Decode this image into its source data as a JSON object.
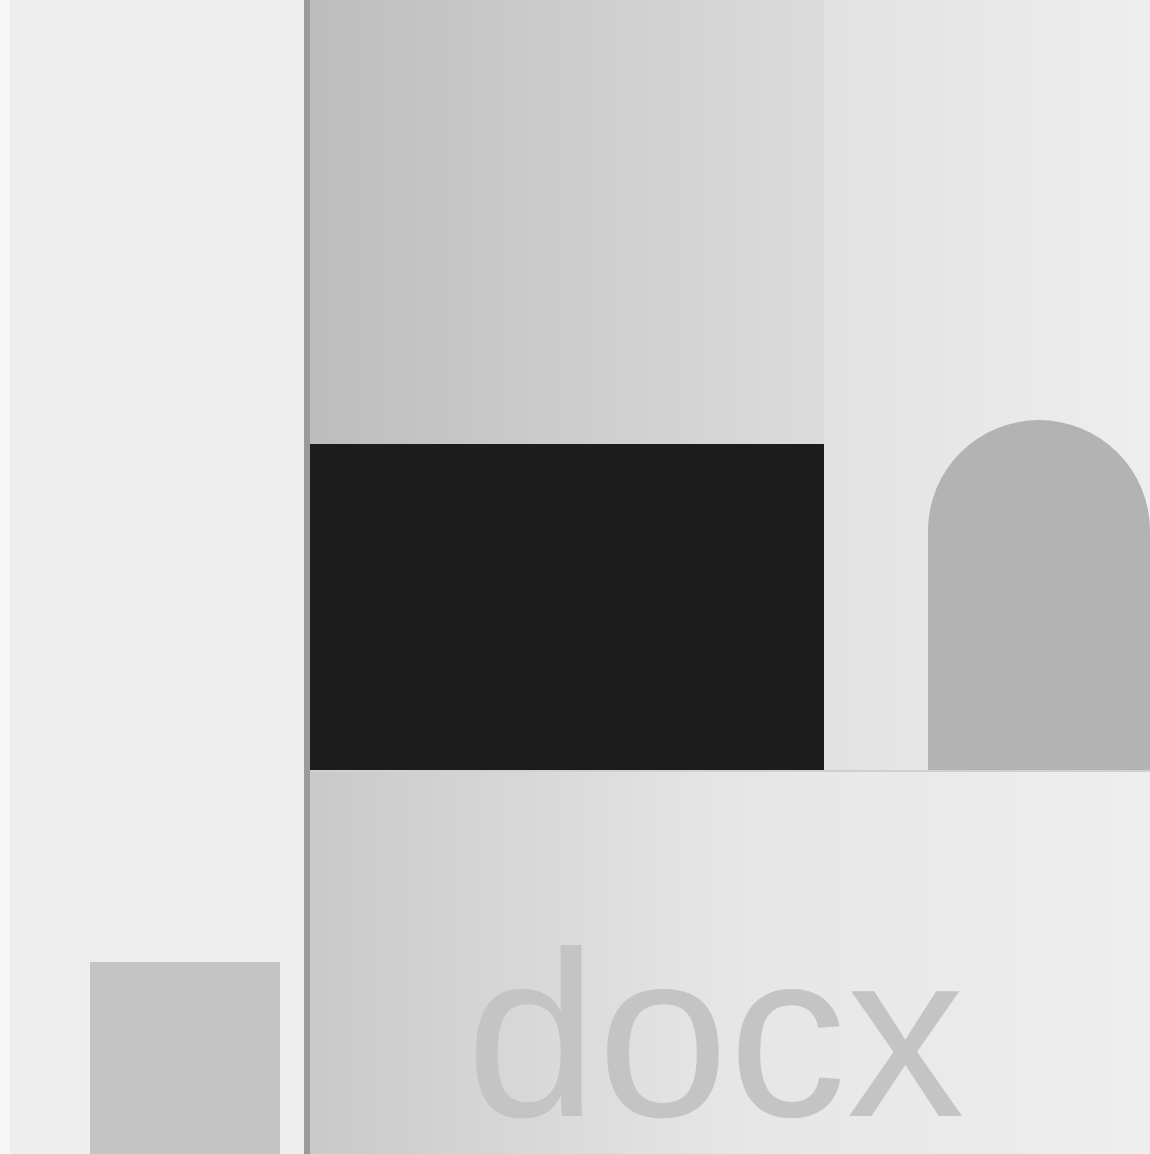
{
  "file_label": {
    "text": "docx"
  }
}
